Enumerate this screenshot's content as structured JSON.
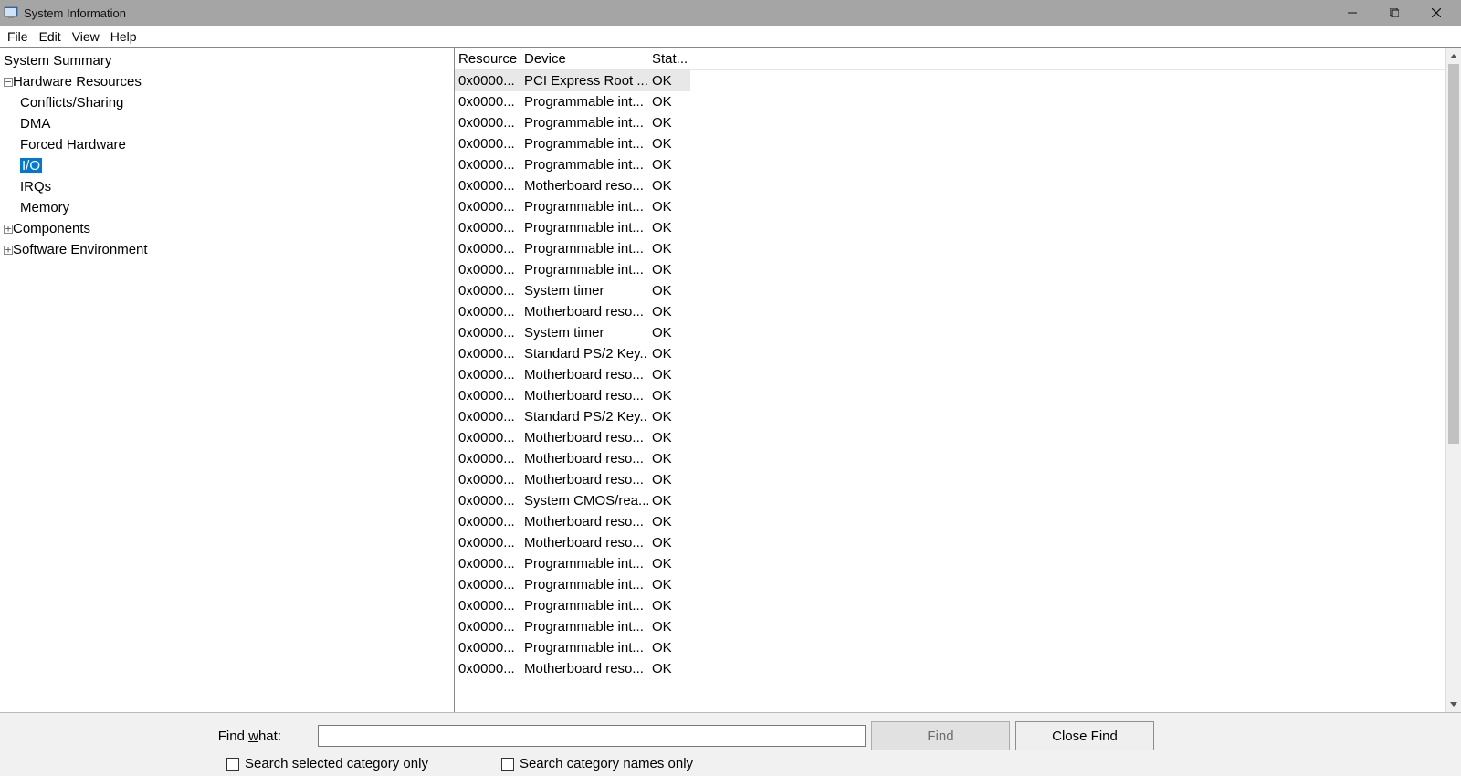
{
  "window": {
    "title": "System Information"
  },
  "menu": {
    "items": [
      "File",
      "Edit",
      "View",
      "Help"
    ]
  },
  "tree": {
    "items": [
      {
        "label": "System Summary",
        "level": 0,
        "expander": "",
        "selected": false
      },
      {
        "label": "Hardware Resources",
        "level": 1,
        "expander": "−",
        "selected": false
      },
      {
        "label": "Conflicts/Sharing",
        "level": 2,
        "expander": "",
        "selected": false
      },
      {
        "label": "DMA",
        "level": 2,
        "expander": "",
        "selected": false
      },
      {
        "label": "Forced Hardware",
        "level": 2,
        "expander": "",
        "selected": false
      },
      {
        "label": "I/O",
        "level": 2,
        "expander": "",
        "selected": true
      },
      {
        "label": "IRQs",
        "level": 2,
        "expander": "",
        "selected": false
      },
      {
        "label": "Memory",
        "level": 2,
        "expander": "",
        "selected": false
      },
      {
        "label": "Components",
        "level": 1,
        "expander": "+",
        "selected": false
      },
      {
        "label": "Software Environment",
        "level": 1,
        "expander": "+",
        "selected": false
      }
    ]
  },
  "list": {
    "columns": [
      "Resource",
      "Device",
      "Stat..."
    ],
    "rows": [
      {
        "resource": "0x0000...",
        "device": "PCI Express Root ...",
        "status": "OK",
        "selected": true
      },
      {
        "resource": "0x0000...",
        "device": "Programmable int...",
        "status": "OK"
      },
      {
        "resource": "0x0000...",
        "device": "Programmable int...",
        "status": "OK"
      },
      {
        "resource": "0x0000...",
        "device": "Programmable int...",
        "status": "OK"
      },
      {
        "resource": "0x0000...",
        "device": "Programmable int...",
        "status": "OK"
      },
      {
        "resource": "0x0000...",
        "device": "Motherboard reso...",
        "status": "OK"
      },
      {
        "resource": "0x0000...",
        "device": "Programmable int...",
        "status": "OK"
      },
      {
        "resource": "0x0000...",
        "device": "Programmable int...",
        "status": "OK"
      },
      {
        "resource": "0x0000...",
        "device": "Programmable int...",
        "status": "OK"
      },
      {
        "resource": "0x0000...",
        "device": "Programmable int...",
        "status": "OK"
      },
      {
        "resource": "0x0000...",
        "device": "System timer",
        "status": "OK"
      },
      {
        "resource": "0x0000...",
        "device": "Motherboard reso...",
        "status": "OK"
      },
      {
        "resource": "0x0000...",
        "device": "System timer",
        "status": "OK"
      },
      {
        "resource": "0x0000...",
        "device": "Standard PS/2 Key...",
        "status": "OK"
      },
      {
        "resource": "0x0000...",
        "device": "Motherboard reso...",
        "status": "OK"
      },
      {
        "resource": "0x0000...",
        "device": "Motherboard reso...",
        "status": "OK"
      },
      {
        "resource": "0x0000...",
        "device": "Standard PS/2 Key...",
        "status": "OK"
      },
      {
        "resource": "0x0000...",
        "device": "Motherboard reso...",
        "status": "OK"
      },
      {
        "resource": "0x0000...",
        "device": "Motherboard reso...",
        "status": "OK"
      },
      {
        "resource": "0x0000...",
        "device": "Motherboard reso...",
        "status": "OK"
      },
      {
        "resource": "0x0000...",
        "device": "System CMOS/rea...",
        "status": "OK"
      },
      {
        "resource": "0x0000...",
        "device": "Motherboard reso...",
        "status": "OK"
      },
      {
        "resource": "0x0000...",
        "device": "Motherboard reso...",
        "status": "OK"
      },
      {
        "resource": "0x0000...",
        "device": "Programmable int...",
        "status": "OK"
      },
      {
        "resource": "0x0000...",
        "device": "Programmable int...",
        "status": "OK"
      },
      {
        "resource": "0x0000...",
        "device": "Programmable int...",
        "status": "OK"
      },
      {
        "resource": "0x0000...",
        "device": "Programmable int...",
        "status": "OK"
      },
      {
        "resource": "0x0000...",
        "device": "Programmable int...",
        "status": "OK"
      },
      {
        "resource": "0x0000...",
        "device": "Motherboard reso...",
        "status": "OK"
      }
    ]
  },
  "find": {
    "label_prefix": "Find ",
    "label_underlined": "w",
    "label_suffix": "hat:",
    "input_value": "",
    "find_button": "Find",
    "close_button": "Close Find",
    "checkbox1": "Search selected category only",
    "checkbox2": "Search category names only"
  }
}
